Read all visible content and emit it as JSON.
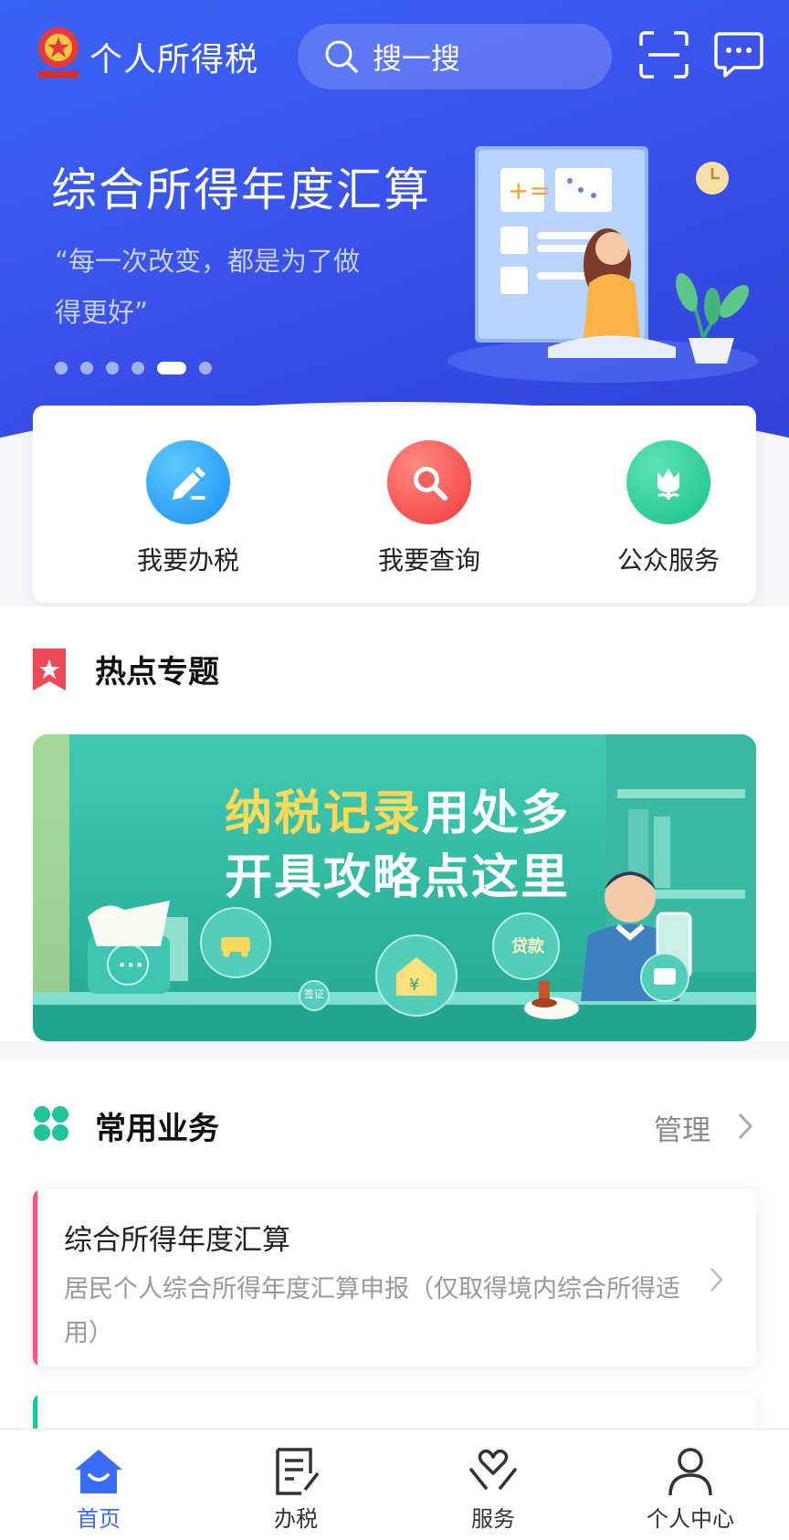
{
  "header": {
    "app_title": "个人所得税",
    "search_placeholder": "搜一搜"
  },
  "banner": {
    "title": "综合所得年度汇算",
    "subtitle": "“每一次改变，都是为了做得更好”",
    "slide_count": 6,
    "active_slide": 5
  },
  "quick_actions": [
    {
      "label": "我要办税",
      "icon": "pen-icon"
    },
    {
      "label": "我要查询",
      "icon": "magnifier-icon"
    },
    {
      "label": "公众服务",
      "icon": "tulip-icon"
    }
  ],
  "hot_topics": {
    "title": "热点专题",
    "promo_highlight": "纳税记录",
    "promo_line1_rest": "用处多",
    "promo_line2": "开具攻略点这里",
    "promo_tags": [
      "贷款",
      "签证"
    ]
  },
  "common": {
    "title": "常用业务",
    "manage_label": "管理",
    "items": [
      {
        "title": "综合所得年度汇算",
        "description": "居民个人综合所得年度汇算申报（仅取得境内综合所得适用）",
        "accent": "#f05a78"
      }
    ]
  },
  "tabbar": {
    "items": [
      {
        "label": "首页",
        "icon": "home-icon",
        "active": true
      },
      {
        "label": "办税",
        "icon": "tax-form-icon",
        "active": false
      },
      {
        "label": "服务",
        "icon": "heart-hands-icon",
        "active": false
      },
      {
        "label": "个人中心",
        "icon": "person-icon",
        "active": false
      }
    ]
  },
  "colors": {
    "primary": "#3a6cf5",
    "hero": "#3a52ea",
    "promo": "#2fb59d"
  }
}
